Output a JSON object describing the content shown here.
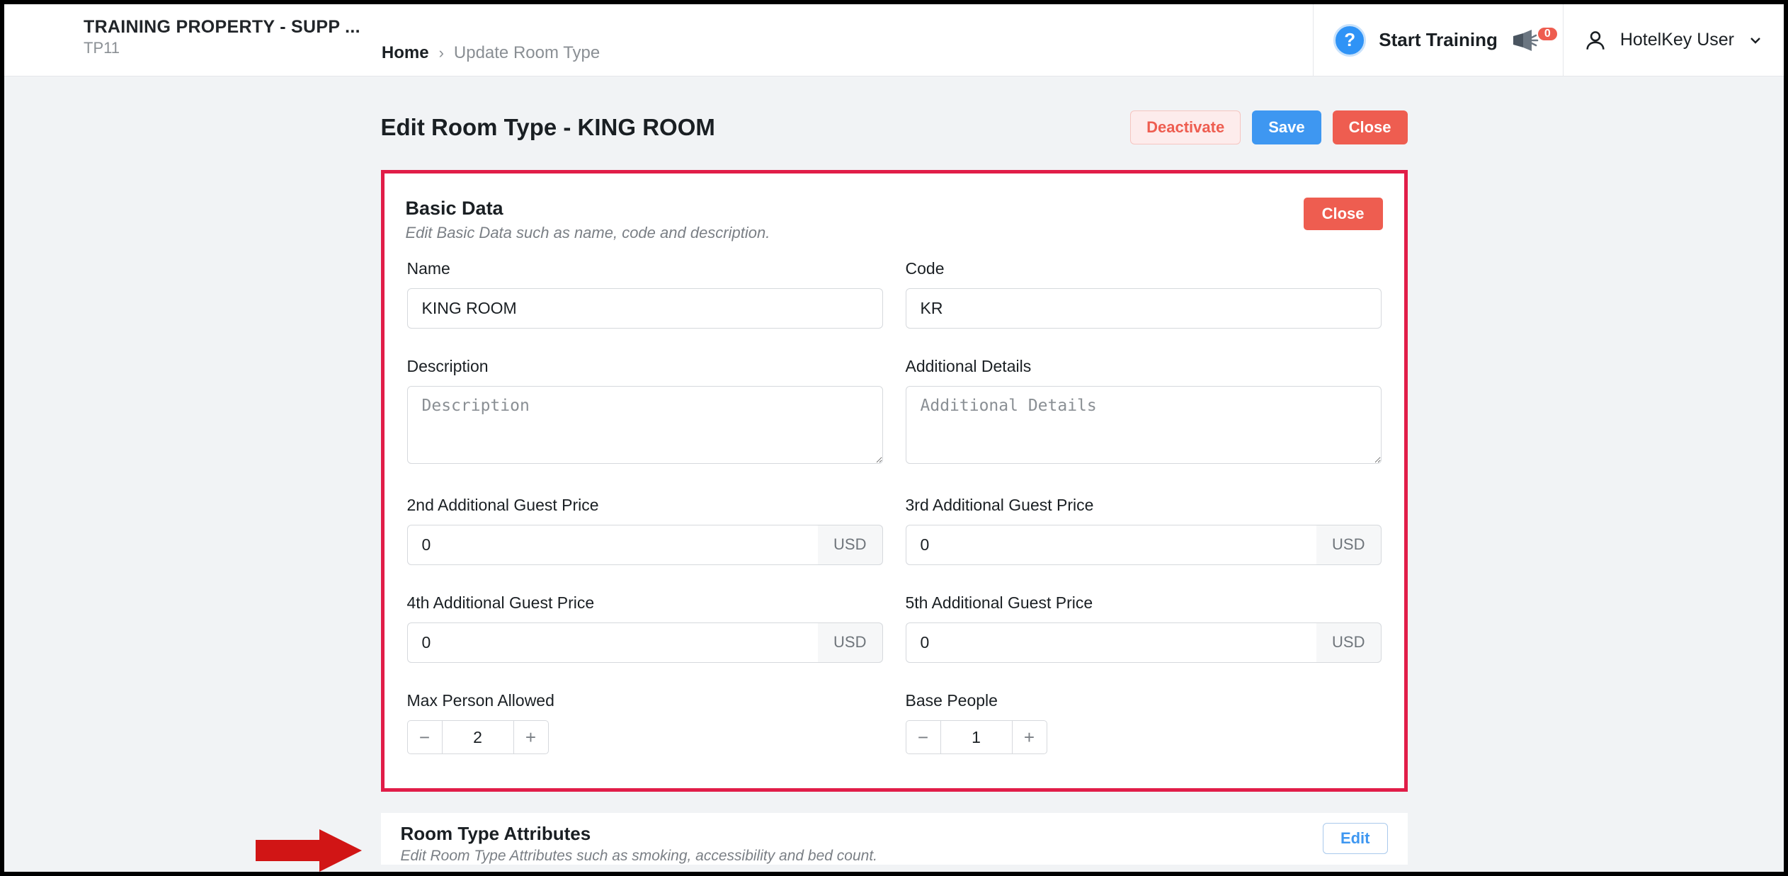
{
  "header": {
    "property_title": "TRAINING PROPERTY - SUPP ...",
    "property_code": "TP11",
    "breadcrumb_home": "Home",
    "breadcrumb_current": "Update Room Type",
    "start_training": "Start Training",
    "notify_count": "0",
    "user_name": "HotelKey User"
  },
  "page": {
    "title": "Edit Room Type - KING ROOM",
    "buttons": {
      "deactivate": "Deactivate",
      "save": "Save",
      "close": "Close"
    }
  },
  "basic": {
    "title": "Basic Data",
    "subtitle": "Edit Basic Data such as name, code and description.",
    "close": "Close",
    "labels": {
      "name": "Name",
      "code": "Code",
      "description": "Description",
      "additional_details": "Additional Details",
      "price2": "2nd Additional Guest Price",
      "price3": "3rd Additional Guest Price",
      "price4": "4th Additional Guest Price",
      "price5": "5th Additional Guest Price",
      "max_person": "Max Person Allowed",
      "base_people": "Base People"
    },
    "values": {
      "name": "KING ROOM",
      "code": "KR",
      "description": "",
      "additional_details": "",
      "price2": "0",
      "price3": "0",
      "price4": "0",
      "price5": "0",
      "max_person": "2",
      "base_people": "1"
    },
    "placeholders": {
      "description": "Description",
      "additional_details": "Additional Details"
    },
    "currency": "USD"
  },
  "attrs": {
    "title": "Room Type Attributes",
    "subtitle": "Edit Room Type Attributes such as smoking, accessibility and bed count.",
    "edit": "Edit"
  }
}
